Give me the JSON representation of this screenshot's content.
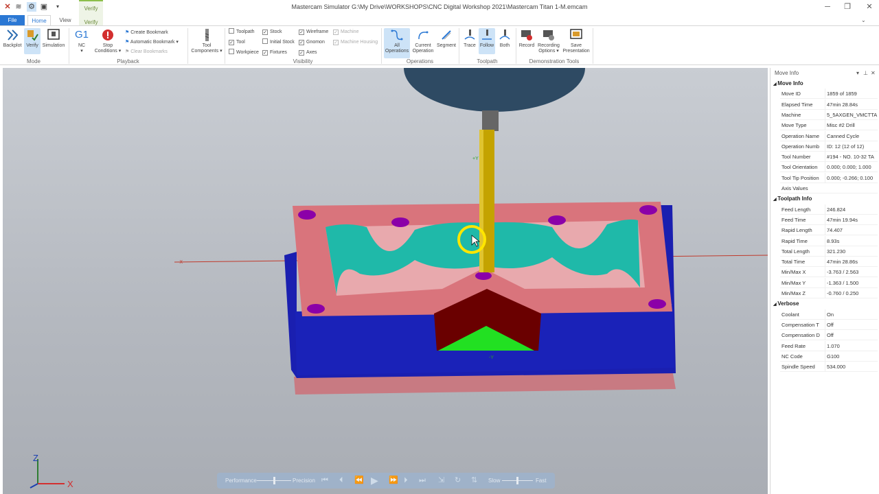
{
  "titlebar": {
    "title": "Mastercam Simulator  G:\\My Drive\\WORKSHOPS\\CNC Digital Workshop 2021\\Mastercam Titan 1-M.emcam",
    "context_group": "Verify",
    "context_tab": "Verify"
  },
  "tabs": {
    "file": "File",
    "home": "Home",
    "view": "View"
  },
  "ribbon": {
    "mode": {
      "label": "Mode",
      "backplot": "Backplot",
      "verify": "Verify",
      "simulation": "Simulation"
    },
    "playback": {
      "label": "Playback",
      "nc": "NC",
      "stop_conditions": "Stop Conditions",
      "create_bookmark": "Create Bookmark",
      "automatic_bookmark": "Automatic Bookmark",
      "clear_bookmarks": "Clear Bookmarks"
    },
    "tool_components": "Tool Components",
    "visibility": {
      "label": "Visibility",
      "toolpath": "Toolpath",
      "tool": "Tool",
      "workpiece": "Workpiece",
      "stock": "Stock",
      "initial_stock": "Initial Stock",
      "fixtures": "Fixtures",
      "wireframe": "Wireframe",
      "gnomon": "Gnomon",
      "axes": "Axes",
      "machine": "Machine",
      "machine_housing": "Machine Housing"
    },
    "operations": {
      "label": "Operations",
      "all": "All Operations",
      "current": "Current Operation",
      "segment": "Segment"
    },
    "toolpath": {
      "label": "Toolpath",
      "trace": "Trace",
      "follow": "Follow",
      "both": "Both"
    },
    "demo": {
      "label": "Demonstration Tools",
      "record": "Record",
      "recording_options": "Recording Options",
      "save_presentation": "Save Presentation"
    },
    "nc_glyph": "G1"
  },
  "panel": {
    "title": "Move Info",
    "move_info_header": "Move Info",
    "move_info": [
      {
        "k": "Move ID",
        "v": "1859 of 1859"
      },
      {
        "k": "Elapsed Time",
        "v": "47min 28.84s"
      },
      {
        "k": "Machine",
        "v": "5_5AXGEN_VMCTTA"
      },
      {
        "k": "Move Type",
        "v": "Misc #2 Drill"
      },
      {
        "k": "Operation Name",
        "v": "Canned Cycle"
      },
      {
        "k": "Operation Numb",
        "v": "ID: 12 (12 of 12)"
      },
      {
        "k": "Tool Number",
        "v": "#194 -  NO. 10-32 TA"
      },
      {
        "k": "Tool Orientation",
        "v": "0.000; 0.000; 1.000"
      },
      {
        "k": "Tool Tip Position",
        "v": "0.000; -0.266; 0.100"
      },
      {
        "k": "Axis Values",
        "v": ""
      }
    ],
    "toolpath_info_header": "Toolpath Info",
    "toolpath_info": [
      {
        "k": "Feed Length",
        "v": "246.824"
      },
      {
        "k": "Feed Time",
        "v": "47min 19.94s"
      },
      {
        "k": "Rapid Length",
        "v": "74.407"
      },
      {
        "k": "Rapid Time",
        "v": "8.93s"
      },
      {
        "k": "Total Length",
        "v": "321.230"
      },
      {
        "k": "Total Time",
        "v": "47min 28.86s"
      },
      {
        "k": "Min/Max X",
        "v": "-3.763 / 2.563"
      },
      {
        "k": "Min/Max Y",
        "v": "-1.363 / 1.500"
      },
      {
        "k": "Min/Max Z",
        "v": "-0.760 / 0.250"
      }
    ],
    "verbose_header": "Verbose",
    "verbose": [
      {
        "k": "Coolant",
        "v": "On"
      },
      {
        "k": "Compensation T",
        "v": "Off"
      },
      {
        "k": "Compensation D",
        "v": "Off"
      },
      {
        "k": "Feed Rate",
        "v": "1.070"
      },
      {
        "k": "NC Code",
        "v": "G100"
      },
      {
        "k": "Spindle Speed",
        "v": "534.000"
      }
    ]
  },
  "playbar": {
    "performance": "Performance",
    "precision": "Precision",
    "slow": "Slow",
    "fast": "Fast"
  },
  "viewport": {
    "axis_x": "X",
    "axis_z": "Z",
    "plus_y": "+Y",
    "minus_y": "-Y",
    "minus_x": "-X"
  }
}
